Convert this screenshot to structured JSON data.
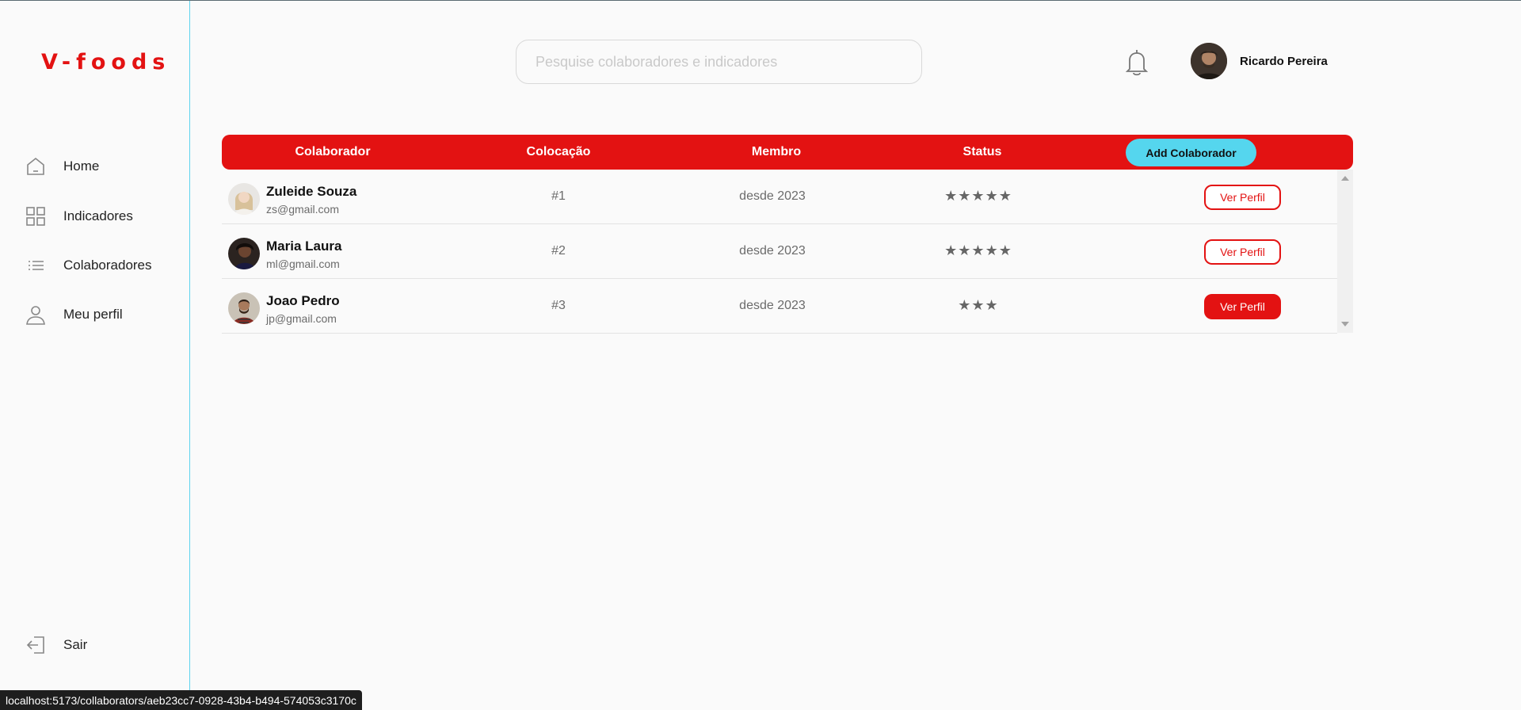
{
  "brand": {
    "logo": "V-foods",
    "accent": "#e31212",
    "secondary": "#55d6ee"
  },
  "sidebar": {
    "items": [
      {
        "label": "Home",
        "icon": "home-icon"
      },
      {
        "label": "Indicadores",
        "icon": "grid-icon"
      },
      {
        "label": "Colaboradores",
        "icon": "list-icon"
      },
      {
        "label": "Meu perfil",
        "icon": "user-icon"
      }
    ],
    "logout": {
      "label": "Sair",
      "icon": "logout-icon"
    }
  },
  "header": {
    "search_placeholder": "Pesquise colaboradores e indicadores",
    "notification_icon": "bell-icon",
    "user_name": "Ricardo Pereira"
  },
  "table": {
    "columns": [
      "Colaborador",
      "Colocação",
      "Membro",
      "Status"
    ],
    "add_button": "Add Colaborador",
    "rows": [
      {
        "name": "Zuleide Souza",
        "email": "zs@gmail.com",
        "rank": "#1",
        "member": "desde 2023",
        "stars": "★★★★★",
        "rating": 5,
        "action": "Ver Perfil"
      },
      {
        "name": "Maria Laura",
        "email": "ml@gmail.com",
        "rank": "#2",
        "member": "desde 2023",
        "stars": "★★★★★",
        "rating": 5,
        "action": "Ver Perfil"
      },
      {
        "name": "Joao Pedro",
        "email": "jp@gmail.com",
        "rank": "#3",
        "member": "desde 2023",
        "stars": "★★★",
        "rating": 3,
        "action": "Ver Perfil"
      }
    ]
  },
  "status_bar": {
    "url": "localhost:5173/collaborators/aeb23cc7-0928-43b4-b494-574053c3170c"
  }
}
